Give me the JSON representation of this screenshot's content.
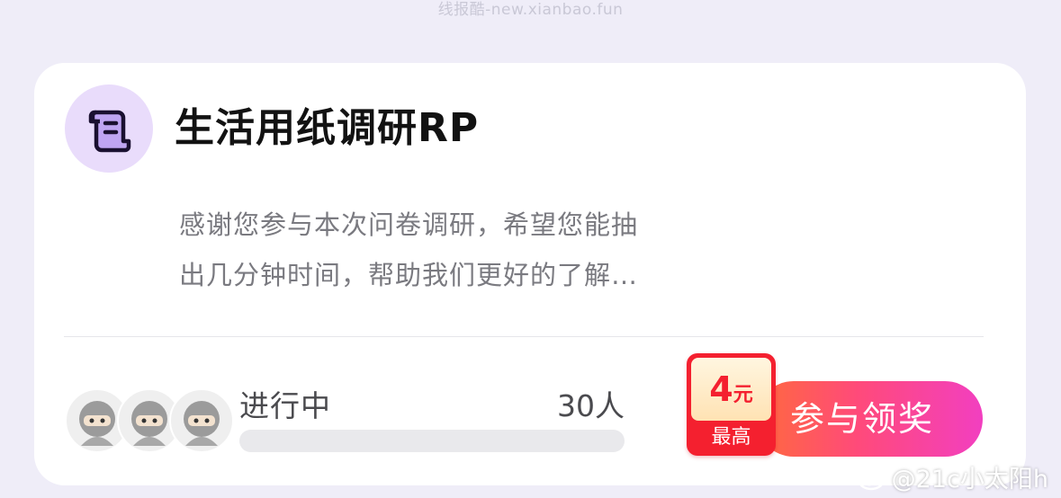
{
  "watermark_top": "线报酷-new.xianbao.fun",
  "survey": {
    "title": "生活用纸调研RP",
    "description_line1": "感谢您参与本次问卷调研，希望您能抽",
    "description_line2": "出几分钟时间，帮助我们更好的了解…",
    "icon": "scroll-document-icon",
    "status": "进行中",
    "participants": "30人",
    "progress_fraction": 0.0,
    "reward": {
      "amount": "4",
      "unit": "元",
      "caption": "最高"
    },
    "join_button": "参与领奖"
  },
  "colors": {
    "background": "#efedf8",
    "icon_bg": "#e9dcfb",
    "badge_red": "#f4202f",
    "button_gradient_start": "#ff6a3d",
    "button_gradient_end": "#f23fc0"
  },
  "watermark_bottom": "@21c小太阳h"
}
